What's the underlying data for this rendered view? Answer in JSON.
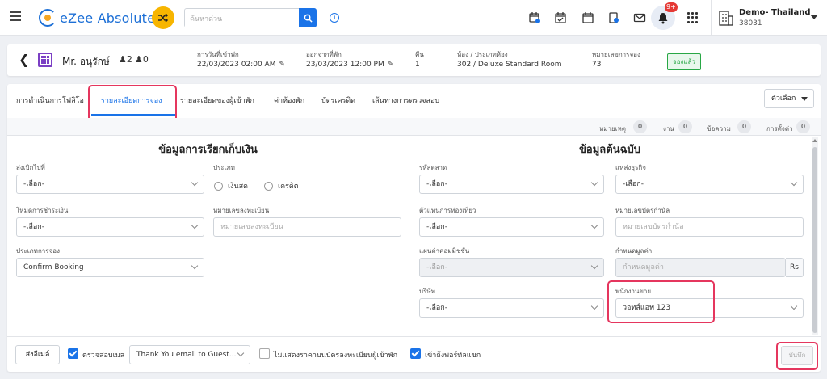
{
  "topbar": {
    "app_name": "eZee Absolute",
    "search_placeholder": "ค้นหาด่วน",
    "notification_count": "9+",
    "property_name": "Demo- Thailand",
    "property_id": "38031",
    "icons": [
      "menu-icon",
      "shuffle-icon",
      "search-icon",
      "info-icon",
      "calendar-add-icon",
      "calendar-check-icon",
      "calendar-icon",
      "document-badge-icon",
      "mail-icon",
      "bell-icon",
      "apps-grid-icon",
      "building-icon"
    ]
  },
  "booking": {
    "guest_name": "Mr. อนุรักษ์",
    "adults": "2",
    "children": "0",
    "arrival_label": "การวันที่เข้าพัก",
    "arrival_value": "22/03/2023 02:00 AM",
    "departure_label": "ออกจากที่พัก",
    "departure_value": "23/03/2023 12:00 PM",
    "nights_label": "คืน",
    "nights_value": "1",
    "room_label": "ห้อง / ประเภทห้อง",
    "room_value": "302 / Deluxe Standard Room",
    "reservation_label": "หมายเลขการจอง",
    "reservation_value": "73",
    "status": "จองแล้ว",
    "status_color": "#28a745"
  },
  "tabs": [
    {
      "label": "การดำเนินการโฟลิโอ"
    },
    {
      "label": "รายละเอียดการจอง"
    },
    {
      "label": "รายละเอียดของผู้เข้าพัก"
    },
    {
      "label": "ค่าห้องพัก"
    },
    {
      "label": "บัตรเครดิต"
    },
    {
      "label": "เส้นทางการตรวจสอบ"
    }
  ],
  "active_tab": "รายละเอียดการจอง",
  "options_label": "ตัวเลือก",
  "counts": [
    {
      "label": "หมายเหตุ",
      "value": "0"
    },
    {
      "label": "งาน",
      "value": "0"
    },
    {
      "label": "ข้อความ",
      "value": "0"
    },
    {
      "label": "การตั้งค่า",
      "value": "0"
    }
  ],
  "billing": {
    "title": "ข้อมูลการเรียกเก็บเงิน",
    "bill_to_label": "ส่งเบิกไปที่",
    "bill_to_value": "-เลือก-",
    "type_label": "ประเภท",
    "type_options": [
      "เงินสด",
      "เครดิต"
    ],
    "payment_mode_label": "โหมดการชำระเงิน",
    "payment_mode_value": "-เลือก-",
    "reg_no_label": "หมายเลขลงทะเบียน",
    "reg_no_placeholder": "หมายเลขลงทะเบียน",
    "booking_type_label": "ประเภทการจอง",
    "booking_type_value": "Confirm Booking"
  },
  "source": {
    "title": "ข้อมูลต้นฉบับ",
    "market_code_label": "รหัสตลาด",
    "market_code_value": "-เลือก-",
    "business_source_label": "แหล่งธุรกิจ",
    "business_source_value": "-เลือก-",
    "travel_agent_label": "ตัวแทนการท่องเที่ยว",
    "travel_agent_value": "-เลือก-",
    "voucher_no_label": "หมายเลขบัตรกำนัล",
    "voucher_no_placeholder": "หมายเลขบัตรกำนัล",
    "commission_plan_label": "แผนค่าคอมมิชชั่น",
    "commission_plan_value": "-เลือก-",
    "value_label": "กำหนดมูลค่า",
    "value_placeholder": "กำหนดมูลค่า",
    "value_unit": "Rs",
    "company_label": "บริษัท",
    "company_value": "-เลือก-",
    "salesperson_label": "พนักงานขาย",
    "salesperson_value": "วอทส์แอพ 123"
  },
  "footer": {
    "send_email_label": "ส่งอีเมล์",
    "check_email_label": "ตรวจสอบเมล",
    "email_template_value": "Thank You email to Guest...",
    "hide_rate_label": "ไม่แสดงราคาบนบัตรลงทะเบียนผู้เข้าพัก",
    "portal_access_label": "เข้าถึงพอร์ทัลแขก",
    "save_label": "บันทึก"
  },
  "colors": {
    "accent": "#1a73e8",
    "highlight": "#e5365e",
    "shuffle": "#f7b500"
  }
}
